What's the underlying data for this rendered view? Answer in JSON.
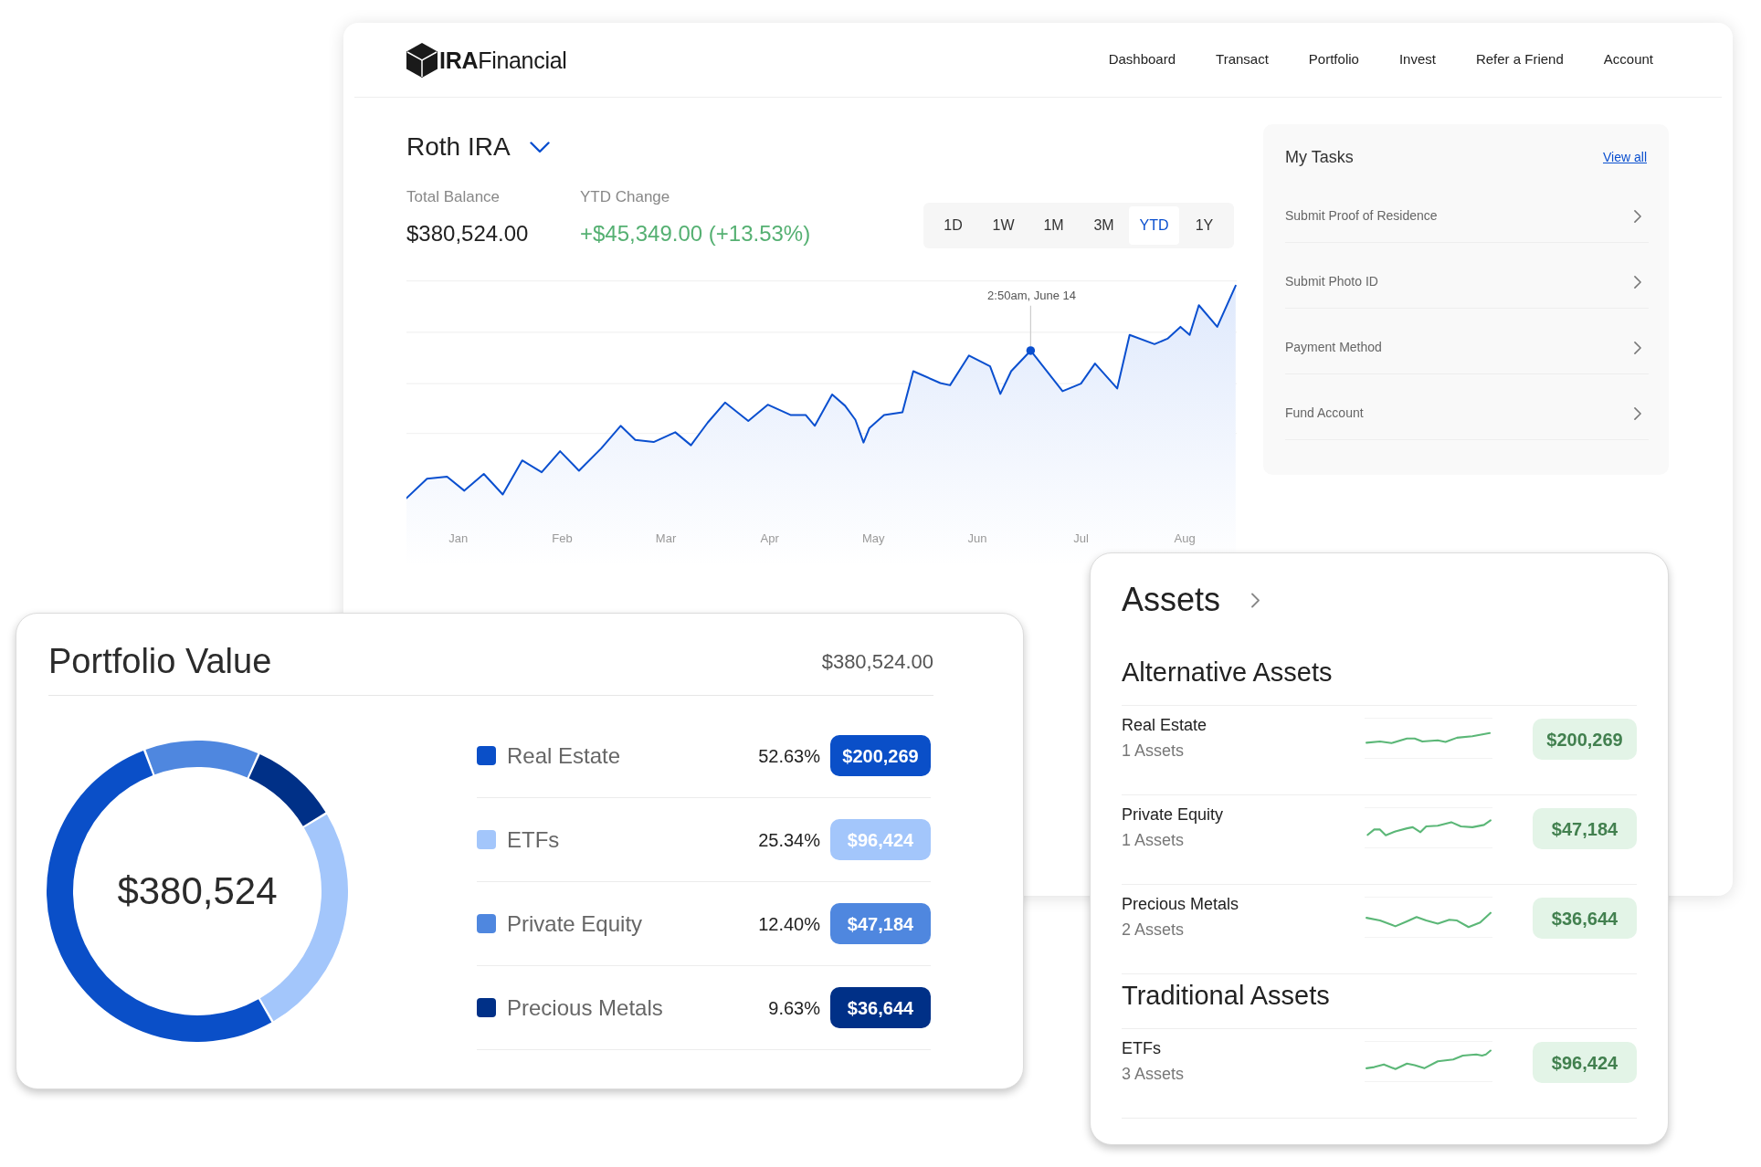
{
  "dashboard": {
    "logo": {
      "text": "**IRA**Financial"
    },
    "nav": [
      "Dashboard",
      "Transact",
      "Portfolio",
      "Invest",
      "Refer a Friend",
      "Account"
    ],
    "account": {
      "title": "Roth IRA"
    },
    "total_balance": {
      "label": "Total Balance",
      "value": "$380,524.00"
    },
    "ytd_change": {
      "label": "YTD Change",
      "value": "+$45,349.00 (+13.53%)"
    },
    "ranges": [
      {
        "label": "1D",
        "selected": false
      },
      {
        "label": "1W",
        "selected": false
      },
      {
        "label": "1M",
        "selected": false
      },
      {
        "label": "3M",
        "selected": false
      },
      {
        "label": "YTD",
        "selected": true
      },
      {
        "label": "1Y",
        "selected": false
      }
    ],
    "balance_chart": {
      "tooltip": "2:50am, June 14",
      "x_labels": [
        "Jan",
        "Feb",
        "Mar",
        "Apr",
        "May",
        "Jun",
        "Jul",
        "Aug"
      ]
    },
    "tasks": {
      "title": "My Tasks",
      "view_all": "View all",
      "items": [
        "Submit Proof of Residence",
        "Submit Photo ID",
        "Payment Method",
        "Fund Account"
      ]
    }
  },
  "portfolio": {
    "title": "Portfolio Value",
    "total": "$380,524.00",
    "center_value": "$380,524",
    "chart_data": {
      "type": "donut",
      "categories": [
        "Real Estate",
        "ETFs",
        "Private Equity",
        "Precious Metals"
      ],
      "values": [
        52.63,
        25.34,
        12.4,
        9.63
      ]
    },
    "legend": [
      {
        "percent": "52.63%",
        "value": "$200,269",
        "color": "#0a4fc8"
      },
      {
        "percent": "25.34%",
        "value": "$96,424",
        "color": "#a3c6fb"
      },
      {
        "percent": "12.40%",
        "value": "$47,184",
        "color": "#4f87df"
      },
      {
        "percent": "9.63%",
        "value": "$36,644",
        "color": "#003087"
      }
    ]
  },
  "assets": {
    "title": "Assets",
    "groups": [
      {
        "title": "Alternative Assets",
        "items": [
          {
            "name": "Real Estate",
            "count": "1 Assets",
            "value": "$200,269"
          },
          {
            "name": "Private Equity",
            "count": "1 Assets",
            "value": "$47,184"
          },
          {
            "name": "Precious Metals",
            "count": "2 Assets",
            "value": "$36,644"
          }
        ]
      },
      {
        "title": "Traditional Assets",
        "items": [
          {
            "name": "ETFs",
            "count": "3 Assets",
            "value": "$96,424"
          }
        ]
      }
    ]
  }
}
